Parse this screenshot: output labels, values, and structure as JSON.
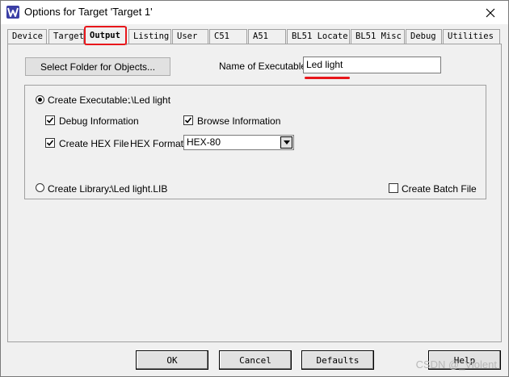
{
  "window": {
    "title": "Options for Target 'Target 1'"
  },
  "tabs": [
    {
      "label": "Device",
      "active": false
    },
    {
      "label": "Target",
      "active": false
    },
    {
      "label": "Output",
      "active": true
    },
    {
      "label": "Listing",
      "active": false
    },
    {
      "label": "User",
      "active": false
    },
    {
      "label": "C51",
      "active": false
    },
    {
      "label": "A51",
      "active": false
    },
    {
      "label": "BL51 Locate",
      "active": false
    },
    {
      "label": "BL51 Misc",
      "active": false
    },
    {
      "label": "Debug",
      "active": false
    },
    {
      "label": "Utilities",
      "active": false
    }
  ],
  "output": {
    "select_folder_label": "Select Folder for Objects...",
    "name_of_executable_label": "Name of Executable:",
    "name_of_executable_value": "Led light",
    "create_executable_label": "Create Executable:",
    "create_executable_path": ".\\Led light",
    "create_executable_selected": true,
    "debug_information_label": "Debug Information",
    "debug_information_checked": true,
    "browse_information_label": "Browse Information",
    "browse_information_checked": true,
    "create_hex_label": "Create HEX File",
    "create_hex_checked": true,
    "hex_format_label": "HEX Format:",
    "hex_format_value": "HEX-80",
    "create_library_label": "Create Library:",
    "create_library_path": ".\\Led light.LIB",
    "create_library_selected": false,
    "create_batch_label": "Create Batch File",
    "create_batch_checked": false
  },
  "footer": {
    "ok_label": "OK",
    "cancel_label": "Cancel",
    "defaults_label": "Defaults",
    "help_label": "Help"
  },
  "watermark": "CSDN @_Violent",
  "colors": {
    "highlight_red": "#e8161b",
    "window_bg": "#f0f0f0"
  }
}
